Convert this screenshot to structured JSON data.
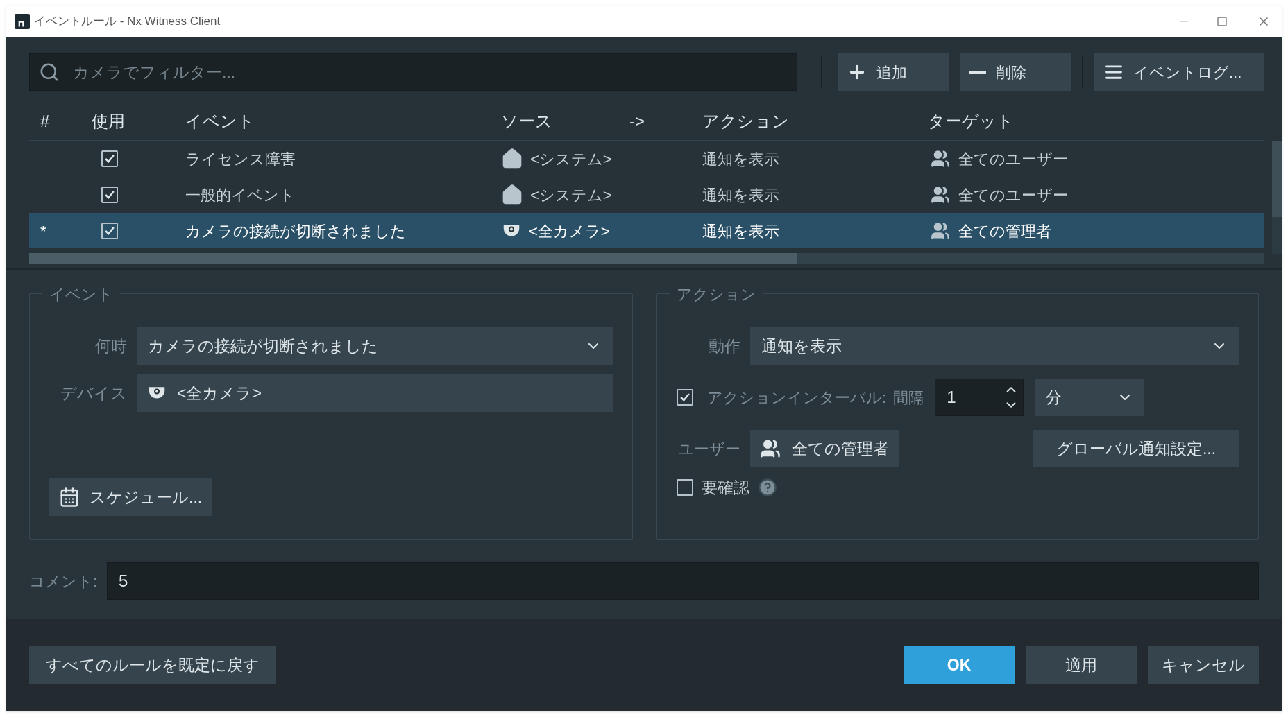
{
  "window": {
    "title": "イベントルール - Nx Witness Client"
  },
  "filter": {
    "placeholder": "カメラでフィルター..."
  },
  "toolbar": [
    {
      "kind": "add",
      "label": "追加"
    },
    {
      "kind": "remove",
      "label": "削除"
    },
    {
      "kind": "log",
      "label": "イベントログ..."
    }
  ],
  "table": {
    "columns": [
      "#",
      "使用",
      "イベント",
      "ソース",
      "->",
      "アクション",
      "ターゲット"
    ],
    "rows": [
      {
        "enabled": true,
        "event": "ライセンス障害",
        "source": {
          "kind": "system",
          "label": "<システム>"
        },
        "action": "通知を表示",
        "target": "全てのユーザー",
        "selected": false
      },
      {
        "enabled": true,
        "event": "一般的イベント",
        "source": {
          "kind": "system",
          "label": "<システム>"
        },
        "action": "通知を表示",
        "target": "全てのユーザー",
        "selected": false
      },
      {
        "mark": "*",
        "enabled": true,
        "event": "カメラの接続が切断されました",
        "source": {
          "kind": "camera",
          "label": "<全カメラ>"
        },
        "action": "通知を表示",
        "target": "全ての管理者",
        "selected": true
      }
    ]
  },
  "event_panel": {
    "title": "イベント",
    "when": {
      "label": "何時",
      "value": "カメラの接続が切断されました"
    },
    "device": {
      "label": "デバイス",
      "value": "<全カメラ>"
    },
    "schedule_button": "スケジュール..."
  },
  "action_panel": {
    "title": "アクション",
    "action": {
      "label": "動作",
      "value": "通知を表示"
    },
    "interval": {
      "checked": true,
      "label": "アクションインターバル:",
      "sublabel": "間隔",
      "value": "1",
      "unit": "分"
    },
    "users": {
      "label": "ユーザー",
      "value": "全ての管理者"
    },
    "global_button": "グローバル通知設定...",
    "confirm": {
      "checked": false,
      "label": "要確認"
    }
  },
  "comment": {
    "label": "コメント:",
    "value": "5"
  },
  "footer": {
    "reset": "すべてのルールを既定に戻す",
    "buttons": [
      {
        "kind": "primary",
        "label": "OK"
      },
      {
        "kind": "secondary",
        "label": "適用"
      },
      {
        "kind": "secondary",
        "label": "キャンセル"
      }
    ]
  }
}
